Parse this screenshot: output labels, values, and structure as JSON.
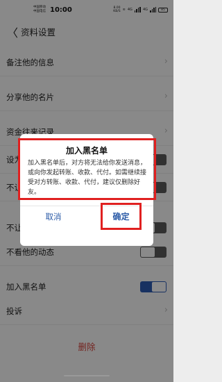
{
  "status_bar": {
    "carrier_1": "中国移动",
    "carrier_2": "中国电信",
    "time": "10:00",
    "speed_value": "8.00",
    "speed_unit": "KB/S",
    "network_1": "4G",
    "network_2": "4G",
    "battery": "85"
  },
  "header": {
    "back_icon": "chevron-left-icon",
    "title": "资料设置"
  },
  "settings": {
    "remark_info": "备注他的信息",
    "share_card": "分享他的名片",
    "fund_records": "资金往来记录",
    "set_as_partial": "设为",
    "dont_let_partial_1": "不让",
    "dont_let_partial_2": "不让",
    "dont_view_moments": "不看他的动态",
    "add_to_blacklist": "加入黑名单",
    "blacklist_enabled": true,
    "report": "投诉",
    "delete": "删除"
  },
  "dialog": {
    "title": "加入黑名单",
    "message": "加入黑名单后，对方将无法给你发送消息，或向你发起转账、收款、代付。如需继续接受对方转账、收款、代付，建议仅删除好友。",
    "cancel": "取消",
    "confirm": "确定"
  },
  "colors": {
    "accent": "#2d5ca8",
    "danger": "#c8403a",
    "highlight": "#e02020"
  }
}
